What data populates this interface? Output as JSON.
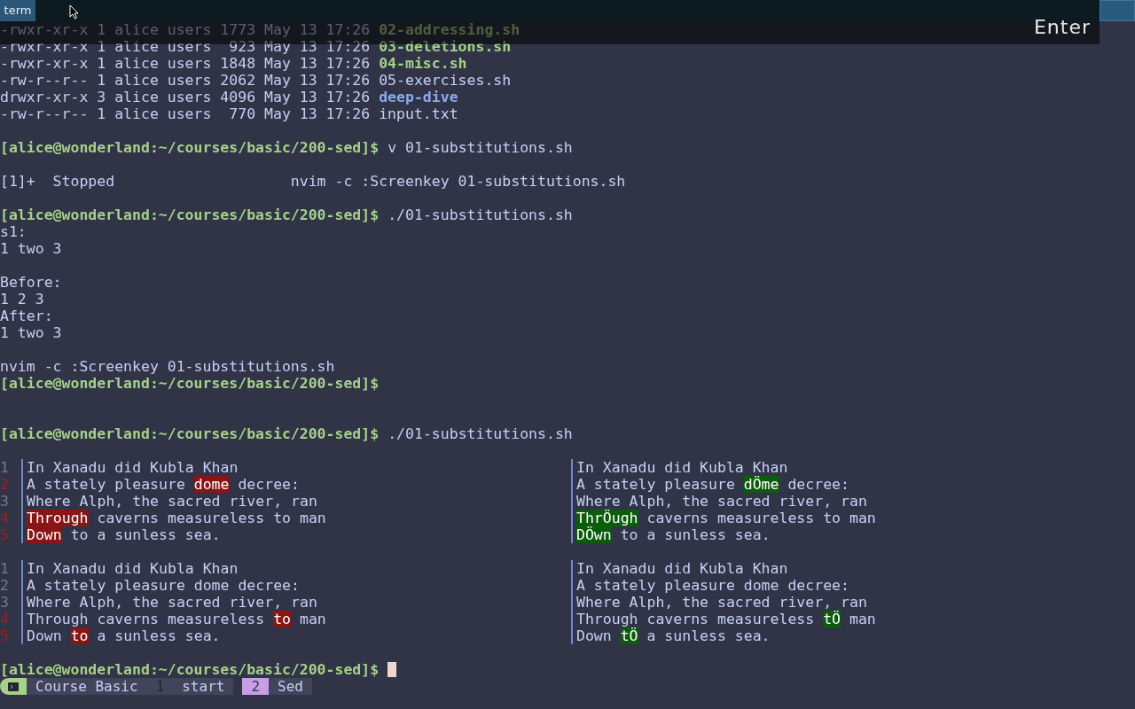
{
  "top_bar": {
    "tab": "term"
  },
  "keystroke": {
    "label": "Enter"
  },
  "lines": [
    {
      "kind": "executable",
      "meta": "-rwxr-xr-x 1 alice users 1773 May 13 17:26",
      "name": "02-addressing.sh"
    },
    {
      "kind": "executable",
      "meta": "-rwxr-xr-x 1 alice users  923 May 13 17:26",
      "name": "03-deletions.sh"
    },
    {
      "kind": "executable",
      "meta": "-rwxr-xr-x 1 alice users 1848 May 13 17:26",
      "name": "04-misc.sh"
    },
    {
      "kind": "file",
      "meta": "-rw-r--r-- 1 alice users 2062 May 13 17:26",
      "name": "05-exercises.sh"
    },
    {
      "kind": "directory",
      "meta": "drwxr-xr-x 3 alice users 4096 May 13 17:26",
      "name": "deep-dive"
    },
    {
      "kind": "file",
      "meta": "-rw-r--r-- 1 alice users  770 May 13 17:26",
      "name": "input.txt"
    },
    {
      "kind": "blank"
    },
    {
      "kind": "prompt",
      "prompt": "[alice@wonderland:~/courses/basic/200-sed]$",
      "command": "v 01-substitutions.sh",
      "cursor": false
    },
    {
      "kind": "blank"
    },
    {
      "kind": "text",
      "text": "[1]+  Stopped                    nvim -c :Screenkey 01-substitutions.sh"
    },
    {
      "kind": "blank"
    },
    {
      "kind": "prompt",
      "prompt": "[alice@wonderland:~/courses/basic/200-sed]$",
      "command": "./01-substitutions.sh",
      "cursor": false
    },
    {
      "kind": "text",
      "text": "s1:"
    },
    {
      "kind": "text",
      "text": "1 two 3"
    },
    {
      "kind": "blank"
    },
    {
      "kind": "text",
      "text": "Before:"
    },
    {
      "kind": "text",
      "text": "1 2 3"
    },
    {
      "kind": "text",
      "text": "After:"
    },
    {
      "kind": "text",
      "text": "1 two 3"
    },
    {
      "kind": "blank"
    },
    {
      "kind": "text",
      "text": "nvim -c :Screenkey 01-substitutions.sh"
    },
    {
      "kind": "prompt",
      "prompt": "[alice@wonderland:~/courses/basic/200-sed]$",
      "cursor": false
    },
    {
      "kind": "blank"
    },
    {
      "kind": "blank"
    },
    {
      "kind": "prompt",
      "prompt": "[alice@wonderland:~/courses/basic/200-sed]$",
      "command": "./01-substitutions.sh",
      "cursor": false
    },
    {
      "kind": "blank"
    },
    {
      "kind": "diff",
      "rows": [
        {
          "number": "1",
          "changed": false,
          "left": [
            {
              "text": "In Xanadu did Kubla Khan",
              "highlight": false
            }
          ],
          "right": [
            {
              "text": "In Xanadu did Kubla Khan",
              "highlight": false
            }
          ]
        },
        {
          "number": "2",
          "changed": true,
          "left": [
            {
              "text": "A stately pleasure ",
              "highlight": false
            },
            {
              "text": "dome",
              "highlight": true
            },
            {
              "text": " decree:",
              "highlight": false
            }
          ],
          "right": [
            {
              "text": "A stately pleasure ",
              "highlight": false
            },
            {
              "text": "dÖme",
              "highlight": true
            },
            {
              "text": " decree:",
              "highlight": false
            }
          ]
        },
        {
          "number": "3",
          "changed": false,
          "left": [
            {
              "text": "Where Alph, the sacred river, ran",
              "highlight": false
            }
          ],
          "right": [
            {
              "text": "Where Alph, the sacred river, ran",
              "highlight": false
            }
          ]
        },
        {
          "number": "4",
          "changed": true,
          "left": [
            {
              "text": "Through",
              "highlight": true
            },
            {
              "text": " caverns measureless to man",
              "highlight": false
            }
          ],
          "right": [
            {
              "text": "ThrÖugh",
              "highlight": true
            },
            {
              "text": " caverns measureless to man",
              "highlight": false
            }
          ]
        },
        {
          "number": "5",
          "changed": true,
          "left": [
            {
              "text": "Down",
              "highlight": true
            },
            {
              "text": " to a sunless sea.",
              "highlight": false
            }
          ],
          "right": [
            {
              "text": "DÖwn",
              "highlight": true
            },
            {
              "text": " to a sunless sea.",
              "highlight": false
            }
          ]
        }
      ]
    },
    {
      "kind": "blank"
    },
    {
      "kind": "diff",
      "rows": [
        {
          "number": "1",
          "changed": false,
          "left": [
            {
              "text": "In Xanadu did Kubla Khan",
              "highlight": false
            }
          ],
          "right": [
            {
              "text": "In Xanadu did Kubla Khan",
              "highlight": false
            }
          ]
        },
        {
          "number": "2",
          "changed": false,
          "left": [
            {
              "text": "A stately pleasure dome decree:",
              "highlight": false
            }
          ],
          "right": [
            {
              "text": "A stately pleasure dome decree:",
              "highlight": false
            }
          ]
        },
        {
          "number": "3",
          "changed": false,
          "left": [
            {
              "text": "Where Alph, the sacred river, ran",
              "highlight": false
            }
          ],
          "right": [
            {
              "text": "Where Alph, the sacred river, ran",
              "highlight": false
            }
          ]
        },
        {
          "number": "4",
          "changed": true,
          "left": [
            {
              "text": "Through caverns measureless ",
              "highlight": false
            },
            {
              "text": "to",
              "highlight": true
            },
            {
              "text": " man",
              "highlight": false
            }
          ],
          "right": [
            {
              "text": "Through caverns measureless ",
              "highlight": false
            },
            {
              "text": "tÖ",
              "highlight": true
            },
            {
              "text": " man",
              "highlight": false
            }
          ]
        },
        {
          "number": "5",
          "changed": true,
          "left": [
            {
              "text": "Down ",
              "highlight": false
            },
            {
              "text": "to",
              "highlight": true
            },
            {
              "text": " a sunless sea.",
              "highlight": false
            }
          ],
          "right": [
            {
              "text": "Down ",
              "highlight": false
            },
            {
              "text": "tÖ",
              "highlight": true
            },
            {
              "text": " a sunless sea.",
              "highlight": false
            }
          ]
        }
      ]
    },
    {
      "kind": "blank"
    },
    {
      "kind": "prompt",
      "prompt": "[alice@wonderland:~/courses/basic/200-sed]$",
      "cursor": true
    }
  ],
  "status_bar": {
    "session": "Course Basic",
    "windows": [
      {
        "index": "1",
        "name": "start",
        "selected": false
      },
      {
        "index": "2",
        "name": "Sed",
        "selected": true
      }
    ]
  }
}
